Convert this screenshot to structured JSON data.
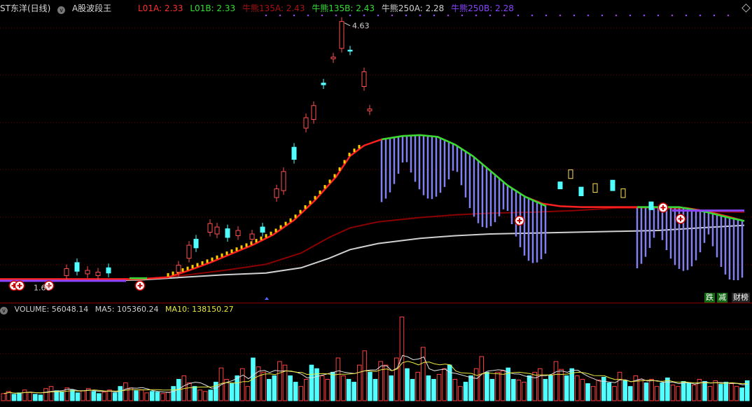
{
  "header": {
    "title": "ST东洋(日线)",
    "indicator": "A股波段王",
    "items": [
      {
        "label": "L01A: 2.33",
        "color": "#ff3030"
      },
      {
        "label": "L01B: 2.33",
        "color": "#33dd33"
      },
      {
        "label": "牛熊135A: 2.43",
        "color": "#aa1111"
      },
      {
        "label": "牛熊135B: 2.43",
        "color": "#33dd33"
      },
      {
        "label": "牛熊250A: 2.28",
        "color": "#d0d0d0"
      },
      {
        "label": "牛熊250B: 2.28",
        "color": "#8844ff"
      }
    ]
  },
  "volume_header": {
    "volume": "VOLUME: 56048.14",
    "ma5": "MA5: 105360.24",
    "ma10": "MA10: 138150.27",
    "colors": {
      "volume": "#d0d0d0",
      "ma5": "#d0d0d0",
      "ma10": "#e8e840"
    }
  },
  "tags": [
    {
      "label": "跌",
      "color": "#116611"
    },
    {
      "label": "减",
      "color": "#116611"
    },
    {
      "label": "财榜",
      "color": "#333333"
    }
  ],
  "annotations": {
    "high": "4.63",
    "low": "1.66"
  },
  "chart_data": {
    "type": "candlestick",
    "title": "ST东洋(日线)",
    "price_range": [
      1.55,
      4.7
    ],
    "high_label": 4.63,
    "low_label": 1.66,
    "lines": {
      "L01A": {
        "color": "#ff2020",
        "value": 2.33,
        "points": [
          [
            0,
            1.66
          ],
          [
            40,
            1.66
          ],
          [
            80,
            1.66
          ],
          [
            120,
            1.66
          ],
          [
            160,
            1.66
          ],
          [
            200,
            1.66
          ],
          [
            240,
            1.68
          ],
          [
            270,
            1.76
          ],
          [
            300,
            1.85
          ],
          [
            330,
            1.95
          ],
          [
            360,
            2.05
          ],
          [
            390,
            2.17
          ],
          [
            420,
            2.34
          ],
          [
            450,
            2.57
          ],
          [
            480,
            2.84
          ],
          [
            500,
            3.08
          ],
          [
            520,
            3.2
          ],
          [
            545,
            3.27
          ],
          [
            575,
            3.31
          ],
          [
            600,
            3.32
          ],
          [
            625,
            3.3
          ],
          [
            650,
            3.21
          ],
          [
            675,
            3.08
          ],
          [
            700,
            2.91
          ],
          [
            725,
            2.74
          ],
          [
            750,
            2.61
          ],
          [
            775,
            2.53
          ],
          [
            800,
            2.5
          ],
          [
            830,
            2.49
          ],
          [
            860,
            2.49
          ],
          [
            890,
            2.49
          ],
          [
            920,
            2.49
          ],
          [
            950,
            2.49
          ],
          [
            980,
            2.48
          ],
          [
            1010,
            2.44
          ],
          [
            1040,
            2.38
          ],
          [
            1063,
            2.33
          ]
        ]
      },
      "L01A_green_segments": [
        [
          [
            185,
            1.67
          ],
          [
            210,
            1.67
          ]
        ],
        [
          [
            545,
            3.27
          ],
          [
            575,
            3.31
          ],
          [
            600,
            3.32
          ],
          [
            625,
            3.3
          ],
          [
            650,
            3.21
          ],
          [
            675,
            3.08
          ],
          [
            700,
            2.91
          ],
          [
            725,
            2.74
          ],
          [
            750,
            2.61
          ],
          [
            780,
            2.5
          ]
        ],
        [
          [
            910,
            2.49
          ],
          [
            930,
            2.49
          ],
          [
            950,
            2.49
          ],
          [
            970,
            2.49
          ],
          [
            990,
            2.46
          ],
          [
            1010,
            2.43
          ],
          [
            1040,
            2.37
          ],
          [
            1063,
            2.33
          ]
        ]
      ],
      "bull135": {
        "color": "#8b0000",
        "value": 2.43,
        "points": [
          [
            0,
            1.64
          ],
          [
            100,
            1.64
          ],
          [
            200,
            1.66
          ],
          [
            260,
            1.7
          ],
          [
            320,
            1.76
          ],
          [
            380,
            1.83
          ],
          [
            430,
            1.96
          ],
          [
            470,
            2.14
          ],
          [
            500,
            2.25
          ],
          [
            540,
            2.32
          ],
          [
            600,
            2.37
          ],
          [
            650,
            2.4
          ],
          [
            700,
            2.42
          ],
          [
            760,
            2.43
          ],
          [
            820,
            2.45
          ],
          [
            880,
            2.48
          ],
          [
            930,
            2.48
          ],
          [
            960,
            2.47
          ],
          [
            1000,
            2.44
          ],
          [
            1063,
            2.43
          ]
        ]
      },
      "bull250": {
        "color": "#d0d0d0",
        "value": 2.28,
        "points": [
          [
            0,
            1.64
          ],
          [
            100,
            1.64
          ],
          [
            200,
            1.65
          ],
          [
            260,
            1.68
          ],
          [
            320,
            1.71
          ],
          [
            380,
            1.73
          ],
          [
            430,
            1.79
          ],
          [
            470,
            1.9
          ],
          [
            500,
            2.0
          ],
          [
            540,
            2.07
          ],
          [
            600,
            2.13
          ],
          [
            650,
            2.16
          ],
          [
            700,
            2.18
          ],
          [
            760,
            2.19
          ],
          [
            820,
            2.2
          ],
          [
            880,
            2.21
          ],
          [
            940,
            2.22
          ],
          [
            1000,
            2.25
          ],
          [
            1063,
            2.28
          ]
        ]
      }
    },
    "volume_range": [
      0,
      240000
    ],
    "volume": [
      20000,
      26000,
      18000,
      22000,
      30000,
      24000,
      18000,
      16000,
      34000,
      40000,
      28000,
      24000,
      36000,
      30000,
      22000,
      28000,
      34000,
      26000,
      20000,
      24000,
      30000,
      22000,
      40000,
      50000,
      36000,
      28000,
      30000,
      22000,
      26000,
      24000,
      20000,
      24000,
      40000,
      60000,
      70000,
      50000,
      40000,
      30000,
      26000,
      30000,
      52000,
      92000,
      60000,
      48000,
      70000,
      90000,
      40000,
      120000,
      95000,
      80000,
      60000,
      70000,
      110000,
      100000,
      70000,
      52000,
      40000,
      60000,
      100000,
      90000,
      70000,
      60000,
      80000,
      120000,
      70000,
      60000,
      52000,
      100000,
      140000,
      80000,
      60000,
      110000,
      100000,
      70000,
      120000,
      235000,
      90000,
      60000,
      80000,
      150000,
      70000,
      60000,
      74000,
      90000,
      100000,
      60000,
      40000,
      52000,
      70000,
      90000,
      124000,
      80000,
      60000,
      80000,
      84000,
      92000,
      60000,
      58000,
      52000,
      70000,
      80000,
      90000,
      60000,
      70000,
      110000,
      88000,
      70000,
      90000,
      70000,
      60000,
      48000,
      40000,
      58000,
      66000,
      50000,
      40000,
      80000,
      56000,
      40000,
      70000,
      60000,
      50000,
      60000,
      40000,
      50000,
      64000,
      44000,
      40000,
      54000,
      50000,
      44000,
      60000,
      54000,
      40000,
      56000,
      46000,
      52000,
      48000,
      40000,
      36000,
      56048
    ]
  }
}
